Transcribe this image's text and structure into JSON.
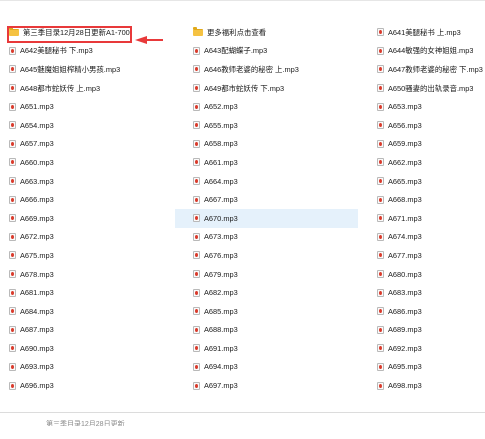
{
  "files": [
    [
      {
        "name": "第三季目录12月28日更新A1-700",
        "type": "folder"
      },
      {
        "name": "更多福利点击查看",
        "type": "folder"
      },
      {
        "name": "A641美腿秘书 上.mp3",
        "type": "mp3"
      }
    ],
    [
      {
        "name": "A642美腿秘书 下.mp3",
        "type": "mp3"
      },
      {
        "name": "A643配蝴蝶子.mp3",
        "type": "mp3"
      },
      {
        "name": "A644敏强的女神姐姐.mp3",
        "type": "mp3"
      }
    ],
    [
      {
        "name": "A645魅魔姐姐榨精小男孩.mp3",
        "type": "mp3"
      },
      {
        "name": "A646教师老婆的秘密 上.mp3",
        "type": "mp3"
      },
      {
        "name": "A647教师老婆的秘密 下.mp3",
        "type": "mp3"
      }
    ],
    [
      {
        "name": "A648都市蛇妖传 上.mp3",
        "type": "mp3"
      },
      {
        "name": "A649都市蛇妖传 下.mp3",
        "type": "mp3"
      },
      {
        "name": "A650骚妻的出轨录音.mp3",
        "type": "mp3"
      }
    ],
    [
      {
        "name": "A651.mp3",
        "type": "mp3"
      },
      {
        "name": "A652.mp3",
        "type": "mp3"
      },
      {
        "name": "A653.mp3",
        "type": "mp3"
      }
    ],
    [
      {
        "name": "A654.mp3",
        "type": "mp3"
      },
      {
        "name": "A655.mp3",
        "type": "mp3"
      },
      {
        "name": "A656.mp3",
        "type": "mp3"
      }
    ],
    [
      {
        "name": "A657.mp3",
        "type": "mp3"
      },
      {
        "name": "A658.mp3",
        "type": "mp3"
      },
      {
        "name": "A659.mp3",
        "type": "mp3"
      }
    ],
    [
      {
        "name": "A660.mp3",
        "type": "mp3"
      },
      {
        "name": "A661.mp3",
        "type": "mp3"
      },
      {
        "name": "A662.mp3",
        "type": "mp3"
      }
    ],
    [
      {
        "name": "A663.mp3",
        "type": "mp3"
      },
      {
        "name": "A664.mp3",
        "type": "mp3"
      },
      {
        "name": "A665.mp3",
        "type": "mp3"
      }
    ],
    [
      {
        "name": "A666.mp3",
        "type": "mp3"
      },
      {
        "name": "A667.mp3",
        "type": "mp3"
      },
      {
        "name": "A668.mp3",
        "type": "mp3"
      }
    ],
    [
      {
        "name": "A669.mp3",
        "type": "mp3"
      },
      {
        "name": "A670.mp3",
        "type": "mp3",
        "selected": true
      },
      {
        "name": "A671.mp3",
        "type": "mp3"
      }
    ],
    [
      {
        "name": "A672.mp3",
        "type": "mp3"
      },
      {
        "name": "A673.mp3",
        "type": "mp3"
      },
      {
        "name": "A674.mp3",
        "type": "mp3"
      }
    ],
    [
      {
        "name": "A675.mp3",
        "type": "mp3"
      },
      {
        "name": "A676.mp3",
        "type": "mp3"
      },
      {
        "name": "A677.mp3",
        "type": "mp3"
      }
    ],
    [
      {
        "name": "A678.mp3",
        "type": "mp3"
      },
      {
        "name": "A679.mp3",
        "type": "mp3"
      },
      {
        "name": "A680.mp3",
        "type": "mp3"
      }
    ],
    [
      {
        "name": "A681.mp3",
        "type": "mp3"
      },
      {
        "name": "A682.mp3",
        "type": "mp3"
      },
      {
        "name": "A683.mp3",
        "type": "mp3"
      }
    ],
    [
      {
        "name": "A684.mp3",
        "type": "mp3"
      },
      {
        "name": "A685.mp3",
        "type": "mp3"
      },
      {
        "name": "A686.mp3",
        "type": "mp3"
      }
    ],
    [
      {
        "name": "A687.mp3",
        "type": "mp3"
      },
      {
        "name": "A688.mp3",
        "type": "mp3"
      },
      {
        "name": "A689.mp3",
        "type": "mp3"
      }
    ],
    [
      {
        "name": "A690.mp3",
        "type": "mp3"
      },
      {
        "name": "A691.mp3",
        "type": "mp3"
      },
      {
        "name": "A692.mp3",
        "type": "mp3"
      }
    ],
    [
      {
        "name": "A693.mp3",
        "type": "mp3"
      },
      {
        "name": "A694.mp3",
        "type": "mp3"
      },
      {
        "name": "A695.mp3",
        "type": "mp3"
      }
    ],
    [
      {
        "name": "A696.mp3",
        "type": "mp3"
      },
      {
        "name": "A697.mp3",
        "type": "mp3"
      },
      {
        "name": "A698.mp3",
        "type": "mp3"
      }
    ]
  ],
  "colors": {
    "highlight": "#e8393a",
    "selection_bg": "#e5f1fb",
    "folder": "#f5c242",
    "mp3_accent": "#d93a2b"
  },
  "icons": {
    "folder": "folder-icon",
    "mp3": "mp3-file-icon"
  },
  "bottom_text": "第三季目录12月28日更新"
}
